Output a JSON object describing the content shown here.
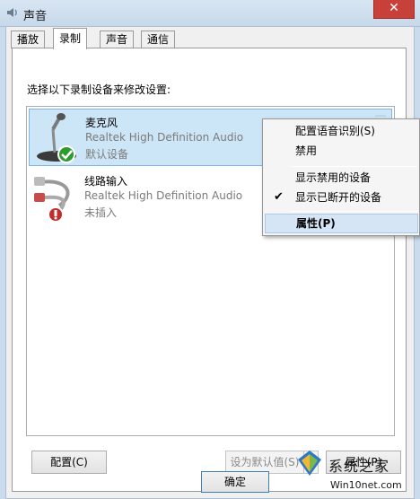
{
  "window": {
    "title": "声音",
    "close_glyph": "✕"
  },
  "tabs": [
    {
      "label": "播放",
      "active": false
    },
    {
      "label": "录制",
      "active": true
    },
    {
      "label": "声音",
      "active": false
    },
    {
      "label": "通信",
      "active": false
    }
  ],
  "instruction": "选择以下录制设备来修改设置:",
  "devices": [
    {
      "name": "麦克风",
      "description": "Realtek High Definition Audio",
      "status": "默认设备",
      "icon": "microphone-icon",
      "badge": "default-check-icon",
      "selected": true
    },
    {
      "name": "线路输入",
      "description": "Realtek High Definition Audio",
      "status": "未插入",
      "icon": "line-in-cable-icon",
      "badge": "unplugged-icon",
      "selected": false
    }
  ],
  "buttons": {
    "configure": "配置(C)",
    "set_default": "设为默认值(S)",
    "set_default_arrow": "▼",
    "properties": "属性(P)",
    "ok": "确定"
  },
  "context_menu": {
    "items": [
      {
        "label": "配置语音识别(S)"
      },
      {
        "label": "禁用"
      },
      {
        "label": "显示禁用的设备",
        "checked": false
      },
      {
        "label": "显示已断开的设备",
        "checked": true
      },
      {
        "label": "属性(P)",
        "bold": true,
        "highlighted": true
      }
    ],
    "check_glyph": "✔"
  },
  "watermark": {
    "text": "系统之家",
    "url": "Win10net.com"
  },
  "colors": {
    "title_bar": "#c9dbed",
    "selection": "#cde6f7",
    "close_button": "#c7403a",
    "menu_highlight": "#d6e5f5",
    "default_badge": "#2e9b2e",
    "unplugged_badge": "#c42b2b"
  }
}
